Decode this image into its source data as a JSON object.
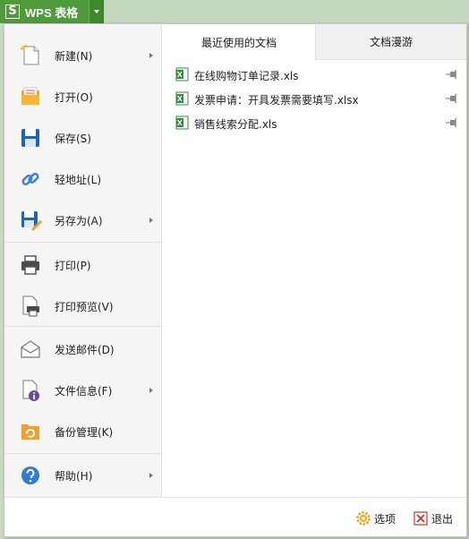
{
  "app": {
    "logo_text": "S",
    "title": "WPS 表格"
  },
  "menu": [
    {
      "label": "新建(N)",
      "icon": "new-document-icon",
      "has_submenu": true
    },
    {
      "label": "打开(O)",
      "icon": "open-folder-icon",
      "has_submenu": false
    },
    {
      "label": "保存(S)",
      "icon": "save-icon",
      "has_submenu": false
    },
    {
      "label": "轻地址(L)",
      "icon": "link-icon",
      "has_submenu": false
    },
    {
      "label": "另存为(A)",
      "icon": "save-as-icon",
      "has_submenu": true
    },
    {
      "label": "打印(P)",
      "icon": "printer-icon",
      "has_submenu": false
    },
    {
      "label": "打印预览(V)",
      "icon": "print-preview-icon",
      "has_submenu": false
    },
    {
      "label": "发送邮件(D)",
      "icon": "mail-icon",
      "has_submenu": false
    },
    {
      "label": "文件信息(F)",
      "icon": "file-info-icon",
      "has_submenu": true
    },
    {
      "label": "备份管理(K)",
      "icon": "backup-icon",
      "has_submenu": false
    },
    {
      "label": "帮助(H)",
      "icon": "help-icon",
      "has_submenu": true
    }
  ],
  "tabs": {
    "recent": "最近使用的文档",
    "roam": "文档漫游"
  },
  "recent_docs": [
    {
      "name": "在线购物订单记录.xls"
    },
    {
      "name": "发票申请：开具发票需要填写.xlsx"
    },
    {
      "name": "销售线索分配.xls"
    }
  ],
  "footer": {
    "options": "选项",
    "exit": "退出"
  },
  "colors": {
    "brand_green": "#4f9a3b",
    "excel_green": "#2e8b3e",
    "accent_orange": "#f0a030",
    "accent_blue": "#1f65b5"
  }
}
